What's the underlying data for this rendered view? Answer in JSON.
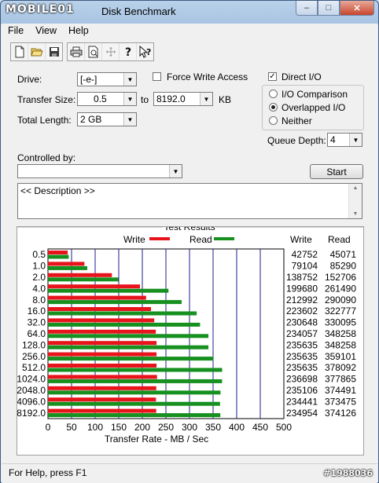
{
  "window": {
    "logo": "MOBILE01",
    "title": "Disk Benchmark",
    "minimize": "–",
    "maximize": "□",
    "close": "✕"
  },
  "menu": [
    "File",
    "View",
    "Help"
  ],
  "toolbar_icons": [
    "new-icon",
    "open-icon",
    "save-icon",
    "print-icon",
    "print-preview-icon",
    "move-icon",
    "help-icon",
    "context-help-icon"
  ],
  "form": {
    "drive_label": "Drive:",
    "drive_value": "[-e-]",
    "force_write_label": "Force Write Access",
    "direct_io_label": "Direct I/O",
    "transfer_size_label": "Transfer Size:",
    "transfer_from": "0.5",
    "to_label": "to",
    "transfer_to": "8192.0",
    "kb_label": "KB",
    "total_length_label": "Total Length:",
    "total_length_value": "2 GB",
    "io_comparison_label": "I/O Comparison",
    "overlapped_io_label": "Overlapped I/O",
    "neither_label": "Neither",
    "queue_depth_label": "Queue Depth:",
    "queue_depth_value": "4",
    "controlled_by_label": "Controlled by:",
    "controlled_by_value": "",
    "start_label": "Start",
    "description_text": "<< Description >>"
  },
  "results": {
    "group_title": "Test Results",
    "legend_write": "Write",
    "legend_read": "Read",
    "col_write": "Write",
    "col_read": "Read",
    "write_color": "#e8141c",
    "read_color": "#16901e"
  },
  "chart_data": {
    "type": "bar",
    "orientation": "horizontal",
    "categories": [
      "0.5",
      "1.0",
      "2.0",
      "4.0",
      "8.0",
      "16.0",
      "32.0",
      "64.0",
      "128.0",
      "256.0",
      "512.0",
      "1024.0",
      "2048.0",
      "4096.0",
      "8192.0"
    ],
    "series": [
      {
        "name": "Write",
        "values": [
          42752,
          79104,
          138752,
          199680,
          212992,
          223602,
          230648,
          234057,
          235635,
          235635,
          235635,
          236698,
          235106,
          234441,
          234954
        ]
      },
      {
        "name": "Read",
        "values": [
          45071,
          85290,
          152706,
          261490,
          290090,
          322777,
          330095,
          348258,
          348258,
          359101,
          378092,
          377865,
          374491,
          373475,
          374126
        ]
      }
    ],
    "xlabel": "Transfer Rate - MB / Sec",
    "xticks": [
      "0",
      "50",
      "100",
      "150",
      "200",
      "250",
      "300",
      "350",
      "400",
      "450",
      "500"
    ],
    "xlim": [
      0,
      500
    ],
    "grid": true,
    "legend": "top-center"
  },
  "status": {
    "help_text": "For Help, press F1",
    "watermark": "#1988036"
  }
}
